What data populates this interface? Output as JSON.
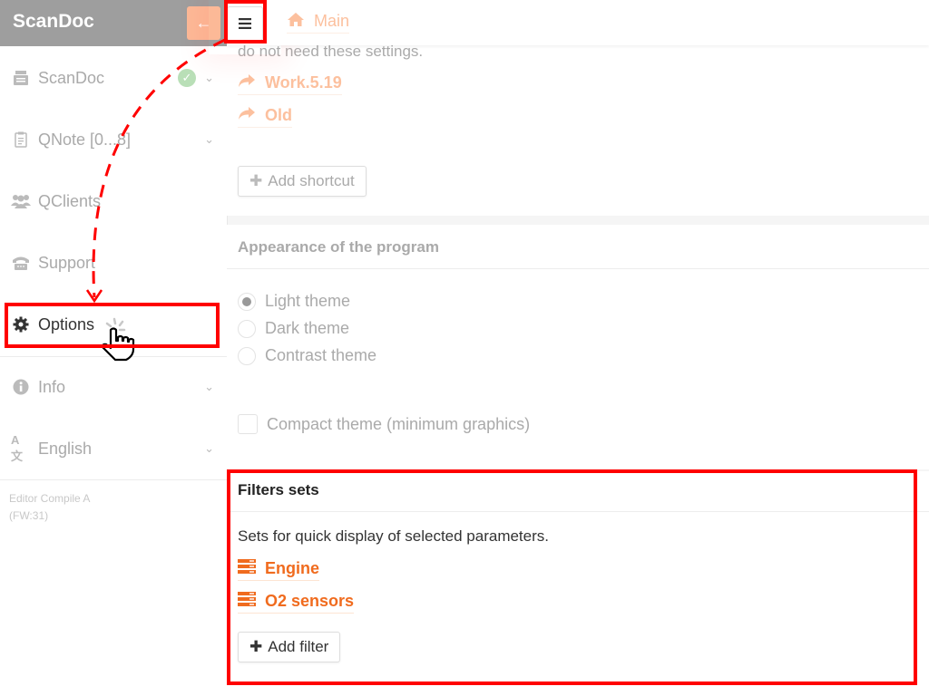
{
  "sidebar": {
    "brand": "ScanDoc",
    "back_icon": "arrow-left-icon",
    "items": [
      {
        "label": "ScanDoc",
        "icon": "printer-icon",
        "has_chevron": true,
        "status_icon": "check-circle-icon"
      },
      {
        "label": "QNote [0...8]",
        "icon": "clipboard-icon",
        "has_chevron": true
      },
      {
        "label": "QClients",
        "icon": "users-icon",
        "has_chevron": false
      },
      {
        "label": "Support",
        "icon": "phone-icon",
        "has_chevron": false
      },
      {
        "label": "Options",
        "icon": "gear-icon",
        "has_chevron": false,
        "active": true
      },
      {
        "label": "Info",
        "icon": "info-icon",
        "has_chevron": true
      },
      {
        "label": "English",
        "icon": "translate-icon",
        "has_chevron": true
      }
    ],
    "footer_line1": "Editor Compile A",
    "footer_line2": "(FW:31)"
  },
  "topbar": {
    "menu_icon": "hamburger-icon",
    "breadcrumb": {
      "icon": "home-icon",
      "label": "Main"
    }
  },
  "shortcuts_card": {
    "description_tail": "do not need these settings.",
    "shortcuts": [
      {
        "label": "Work.5.19",
        "icon": "share-arrow-icon"
      },
      {
        "label": "Old",
        "icon": "share-arrow-icon"
      }
    ],
    "add_button": "Add shortcut"
  },
  "appearance_card": {
    "title": "Appearance of the program",
    "themes": [
      {
        "label": "Light theme",
        "selected": true
      },
      {
        "label": "Dark theme",
        "selected": false
      },
      {
        "label": "Contrast theme",
        "selected": false
      }
    ],
    "compact_label": "Compact theme (minimum graphics)",
    "compact_checked": false
  },
  "filters_card": {
    "title": "Filters sets",
    "description": "Sets for quick display of selected parameters.",
    "filters": [
      {
        "label": "Engine",
        "icon": "list-icon"
      },
      {
        "label": "O2 sensors",
        "icon": "list-icon"
      }
    ],
    "add_button": "Add filter"
  },
  "colors": {
    "accent": "#f06b1e",
    "accent_faded": "#fcc09e",
    "header_gray": "#9e9e9e",
    "highlight": "#ff0000"
  }
}
